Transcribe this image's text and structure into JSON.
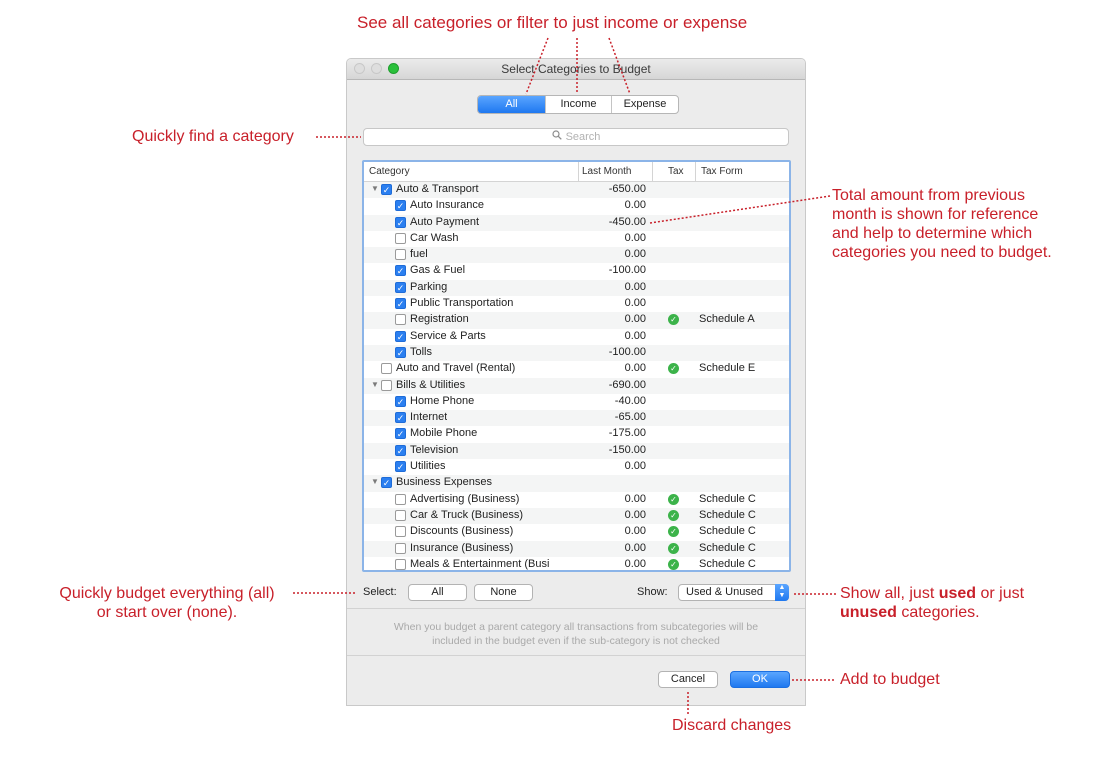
{
  "annotations": {
    "top": "See  all categories or filter to just income or expense",
    "search": "Quickly find a category",
    "total_1": "Total amount from previous",
    "total_2": "month is shown for reference",
    "total_3": "and help to determine which",
    "total_4": "categories you need to budget.",
    "select_1": "Quickly  budget everything (all)",
    "select_2": "or start over  (none).",
    "show_pre": "Show all, just ",
    "show_used": "used",
    "show_mid": " or just",
    "show_unused": "unused",
    "show_post": " categories.",
    "add": "Add to budget",
    "discard": "Discard changes"
  },
  "window": {
    "title": "Select Categories to Budget"
  },
  "filter_tabs": [
    {
      "label": "All",
      "selected": true
    },
    {
      "label": "Income",
      "selected": false
    },
    {
      "label": "Expense",
      "selected": false
    }
  ],
  "search": {
    "placeholder": "Search"
  },
  "table": {
    "columns": [
      "Category",
      "Last Month",
      "Tax",
      "Tax Form"
    ],
    "rows": [
      {
        "level": 0,
        "expandable": true,
        "checked": true,
        "name": "Auto & Transport",
        "amount": "-650.00",
        "tax": false,
        "form": ""
      },
      {
        "level": 1,
        "checked": true,
        "name": "Auto Insurance",
        "amount": "0.00",
        "tax": false,
        "form": ""
      },
      {
        "level": 1,
        "checked": true,
        "name": "Auto Payment",
        "amount": "-450.00",
        "tax": false,
        "form": ""
      },
      {
        "level": 1,
        "checked": false,
        "name": "Car Wash",
        "amount": "0.00",
        "tax": false,
        "form": ""
      },
      {
        "level": 1,
        "checked": false,
        "name": "fuel",
        "amount": "0.00",
        "tax": false,
        "form": ""
      },
      {
        "level": 1,
        "checked": true,
        "name": "Gas & Fuel",
        "amount": "-100.00",
        "tax": false,
        "form": ""
      },
      {
        "level": 1,
        "checked": true,
        "name": "Parking",
        "amount": "0.00",
        "tax": false,
        "form": ""
      },
      {
        "level": 1,
        "checked": true,
        "name": "Public Transportation",
        "amount": "0.00",
        "tax": false,
        "form": ""
      },
      {
        "level": 1,
        "checked": false,
        "name": "Registration",
        "amount": "0.00",
        "tax": true,
        "form": "Schedule A"
      },
      {
        "level": 1,
        "checked": true,
        "name": "Service & Parts",
        "amount": "0.00",
        "tax": false,
        "form": ""
      },
      {
        "level": 1,
        "checked": true,
        "name": "Tolls",
        "amount": "-100.00",
        "tax": false,
        "form": ""
      },
      {
        "level": 0,
        "expandable": false,
        "checked": false,
        "name": "Auto and Travel (Rental)",
        "amount": "0.00",
        "tax": true,
        "form": "Schedule E"
      },
      {
        "level": 0,
        "expandable": true,
        "checked": false,
        "name": "Bills & Utilities",
        "amount": "-690.00",
        "tax": false,
        "form": ""
      },
      {
        "level": 1,
        "checked": true,
        "name": "Home Phone",
        "amount": "-40.00",
        "tax": false,
        "form": ""
      },
      {
        "level": 1,
        "checked": true,
        "name": "Internet",
        "amount": "-65.00",
        "tax": false,
        "form": ""
      },
      {
        "level": 1,
        "checked": true,
        "name": "Mobile Phone",
        "amount": "-175.00",
        "tax": false,
        "form": ""
      },
      {
        "level": 1,
        "checked": true,
        "name": "Television",
        "amount": "-150.00",
        "tax": false,
        "form": ""
      },
      {
        "level": 1,
        "checked": true,
        "name": "Utilities",
        "amount": "0.00",
        "tax": false,
        "form": ""
      },
      {
        "level": 0,
        "expandable": true,
        "checked": true,
        "name": "Business Expenses",
        "amount": "",
        "tax": false,
        "form": ""
      },
      {
        "level": 1,
        "checked": false,
        "name": "Advertising (Business)",
        "amount": "0.00",
        "tax": true,
        "form": "Schedule C"
      },
      {
        "level": 1,
        "checked": false,
        "name": "Car & Truck (Business)",
        "amount": "0.00",
        "tax": true,
        "form": "Schedule C"
      },
      {
        "level": 1,
        "checked": false,
        "name": "Discounts (Business)",
        "amount": "0.00",
        "tax": true,
        "form": "Schedule C"
      },
      {
        "level": 1,
        "checked": false,
        "name": "Insurance (Business)",
        "amount": "0.00",
        "tax": true,
        "form": "Schedule C"
      },
      {
        "level": 1,
        "checked": false,
        "name": "Meals & Entertainment (Busi",
        "amount": "0.00",
        "tax": true,
        "form": "Schedule C"
      }
    ]
  },
  "select": {
    "label": "Select:",
    "all": "All",
    "none": "None"
  },
  "show": {
    "label": "Show:",
    "value": "Used & Unused"
  },
  "note": {
    "line1": "When you budget a parent category all transactions from subcategories will be",
    "line2": "included in the budget even if the sub-category is not checked"
  },
  "buttons": {
    "cancel": "Cancel",
    "ok": "OK"
  },
  "colors": {
    "annotation": "#c8202a",
    "accent": "#1f78f0",
    "tax_check": "#3cb34a"
  }
}
